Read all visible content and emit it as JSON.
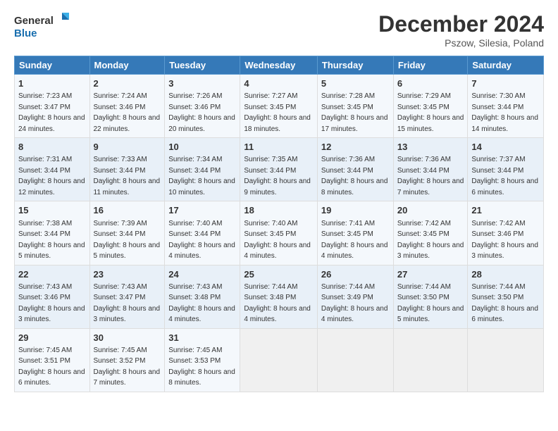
{
  "logo": {
    "line1": "General",
    "line2": "Blue"
  },
  "title": "December 2024",
  "subtitle": "Pszow, Silesia, Poland",
  "days_of_week": [
    "Sunday",
    "Monday",
    "Tuesday",
    "Wednesday",
    "Thursday",
    "Friday",
    "Saturday"
  ],
  "weeks": [
    [
      {
        "day": "1",
        "sunrise": "7:23 AM",
        "sunset": "3:47 PM",
        "daylight": "8 hours and 24 minutes."
      },
      {
        "day": "2",
        "sunrise": "7:24 AM",
        "sunset": "3:46 PM",
        "daylight": "8 hours and 22 minutes."
      },
      {
        "day": "3",
        "sunrise": "7:26 AM",
        "sunset": "3:46 PM",
        "daylight": "8 hours and 20 minutes."
      },
      {
        "day": "4",
        "sunrise": "7:27 AM",
        "sunset": "3:45 PM",
        "daylight": "8 hours and 18 minutes."
      },
      {
        "day": "5",
        "sunrise": "7:28 AM",
        "sunset": "3:45 PM",
        "daylight": "8 hours and 17 minutes."
      },
      {
        "day": "6",
        "sunrise": "7:29 AM",
        "sunset": "3:45 PM",
        "daylight": "8 hours and 15 minutes."
      },
      {
        "day": "7",
        "sunrise": "7:30 AM",
        "sunset": "3:44 PM",
        "daylight": "8 hours and 14 minutes."
      }
    ],
    [
      {
        "day": "8",
        "sunrise": "7:31 AM",
        "sunset": "3:44 PM",
        "daylight": "8 hours and 12 minutes."
      },
      {
        "day": "9",
        "sunrise": "7:33 AM",
        "sunset": "3:44 PM",
        "daylight": "8 hours and 11 minutes."
      },
      {
        "day": "10",
        "sunrise": "7:34 AM",
        "sunset": "3:44 PM",
        "daylight": "8 hours and 10 minutes."
      },
      {
        "day": "11",
        "sunrise": "7:35 AM",
        "sunset": "3:44 PM",
        "daylight": "8 hours and 9 minutes."
      },
      {
        "day": "12",
        "sunrise": "7:36 AM",
        "sunset": "3:44 PM",
        "daylight": "8 hours and 8 minutes."
      },
      {
        "day": "13",
        "sunrise": "7:36 AM",
        "sunset": "3:44 PM",
        "daylight": "8 hours and 7 minutes."
      },
      {
        "day": "14",
        "sunrise": "7:37 AM",
        "sunset": "3:44 PM",
        "daylight": "8 hours and 6 minutes."
      }
    ],
    [
      {
        "day": "15",
        "sunrise": "7:38 AM",
        "sunset": "3:44 PM",
        "daylight": "8 hours and 5 minutes."
      },
      {
        "day": "16",
        "sunrise": "7:39 AM",
        "sunset": "3:44 PM",
        "daylight": "8 hours and 5 minutes."
      },
      {
        "day": "17",
        "sunrise": "7:40 AM",
        "sunset": "3:44 PM",
        "daylight": "8 hours and 4 minutes."
      },
      {
        "day": "18",
        "sunrise": "7:40 AM",
        "sunset": "3:45 PM",
        "daylight": "8 hours and 4 minutes."
      },
      {
        "day": "19",
        "sunrise": "7:41 AM",
        "sunset": "3:45 PM",
        "daylight": "8 hours and 4 minutes."
      },
      {
        "day": "20",
        "sunrise": "7:42 AM",
        "sunset": "3:45 PM",
        "daylight": "8 hours and 3 minutes."
      },
      {
        "day": "21",
        "sunrise": "7:42 AM",
        "sunset": "3:46 PM",
        "daylight": "8 hours and 3 minutes."
      }
    ],
    [
      {
        "day": "22",
        "sunrise": "7:43 AM",
        "sunset": "3:46 PM",
        "daylight": "8 hours and 3 minutes."
      },
      {
        "day": "23",
        "sunrise": "7:43 AM",
        "sunset": "3:47 PM",
        "daylight": "8 hours and 3 minutes."
      },
      {
        "day": "24",
        "sunrise": "7:43 AM",
        "sunset": "3:48 PM",
        "daylight": "8 hours and 4 minutes."
      },
      {
        "day": "25",
        "sunrise": "7:44 AM",
        "sunset": "3:48 PM",
        "daylight": "8 hours and 4 minutes."
      },
      {
        "day": "26",
        "sunrise": "7:44 AM",
        "sunset": "3:49 PM",
        "daylight": "8 hours and 4 minutes."
      },
      {
        "day": "27",
        "sunrise": "7:44 AM",
        "sunset": "3:50 PM",
        "daylight": "8 hours and 5 minutes."
      },
      {
        "day": "28",
        "sunrise": "7:44 AM",
        "sunset": "3:50 PM",
        "daylight": "8 hours and 6 minutes."
      }
    ],
    [
      {
        "day": "29",
        "sunrise": "7:45 AM",
        "sunset": "3:51 PM",
        "daylight": "8 hours and 6 minutes."
      },
      {
        "day": "30",
        "sunrise": "7:45 AM",
        "sunset": "3:52 PM",
        "daylight": "8 hours and 7 minutes."
      },
      {
        "day": "31",
        "sunrise": "7:45 AM",
        "sunset": "3:53 PM",
        "daylight": "8 hours and 8 minutes."
      },
      null,
      null,
      null,
      null
    ]
  ],
  "labels": {
    "sunrise": "Sunrise:",
    "sunset": "Sunset:",
    "daylight": "Daylight:"
  }
}
